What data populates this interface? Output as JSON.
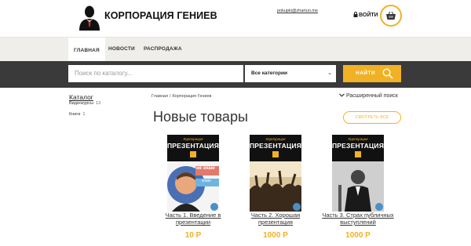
{
  "header": {
    "brand": "КОРПОРАЦИЯ ГЕНИЕВ",
    "email": "pokupki@zhartun.me",
    "login_label": "ВОЙТИ"
  },
  "nav": {
    "items": [
      {
        "label": "ГЛАВНАЯ"
      },
      {
        "label": "НОВОСТИ"
      },
      {
        "label": "РАСПРОДАЖА"
      }
    ]
  },
  "search": {
    "placeholder": "Поиск по каталогу...",
    "category": "Все категории",
    "button": "НАЙТИ"
  },
  "sidebar": {
    "title": "Каталог",
    "items": [
      {
        "label": "Видеокурсы",
        "count": "13"
      },
      {
        "label": "Книги",
        "count": "1"
      }
    ]
  },
  "breadcrumb": {
    "home": "Главная",
    "separator": "/",
    "current": "Корпорация Гениев"
  },
  "advanced_search": "Расширенный поиск",
  "section": {
    "title": "Новые товары",
    "view_all": "СМОТРЕТЬ ВСЕ"
  },
  "products": [
    {
      "cover_top": "Корпорация",
      "cover_title": "ПРЕЗЕНТАЦИЯ",
      "badge_top": "не знаю",
      "badge_bottom": "знаю",
      "title": "Часть 1. Введение в презентации",
      "price": "10 Р"
    },
    {
      "cover_top": "Корпорация",
      "cover_title": "ПРЕЗЕНТАЦИЯ",
      "title": "Часть 2. Хорошая презентация",
      "price": "1000 Р"
    },
    {
      "cover_top": "Корпорация",
      "cover_title": "ПРЕЗЕНТАЦИЯ",
      "title": "Часть 3. Страх публичных выступлений",
      "price": "1000 Р"
    }
  ],
  "colors": {
    "accent": "#f2b124",
    "dark_bar": "#3a3a3a",
    "nav_bg": "#f0eeeb"
  }
}
